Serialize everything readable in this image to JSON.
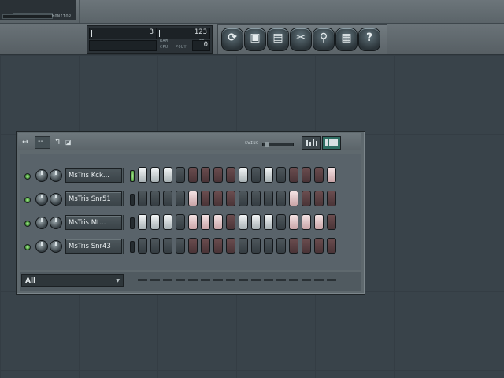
{
  "top_panel": {
    "monitor_label": "MONITOR",
    "pattern_number": "3",
    "tempo": "123",
    "ram_label": "RAM",
    "mb_label": "MB",
    "cpu_label": "CPU",
    "poly_label": "POLY",
    "poly_value": "0"
  },
  "toolbar": {
    "buttons": [
      {
        "name": "refresh-icon",
        "glyph": "⟳"
      },
      {
        "name": "save-as-icon",
        "glyph": "▣"
      },
      {
        "name": "save-icon",
        "glyph": "▤"
      },
      {
        "name": "tools-icon",
        "glyph": "✂"
      },
      {
        "name": "search-icon",
        "glyph": "⚲"
      },
      {
        "name": "document-icon",
        "glyph": "▦"
      },
      {
        "name": "help-icon",
        "glyph": "?"
      }
    ]
  },
  "channel_rack": {
    "title_icons": [
      "↔",
      "--",
      "↰",
      "◪"
    ],
    "swing_label": "SWING",
    "swing_level": 0.1,
    "channels": [
      {
        "name": "MsTris Kck...",
        "selected": true,
        "steps": [
          1,
          1,
          1,
          0,
          0,
          0,
          0,
          0,
          1,
          0,
          1,
          0,
          0,
          0,
          0,
          1
        ]
      },
      {
        "name": "MsTris Snr51",
        "selected": false,
        "steps": [
          0,
          0,
          0,
          0,
          1,
          0,
          0,
          0,
          0,
          0,
          0,
          0,
          1,
          0,
          0,
          0
        ]
      },
      {
        "name": "MsTris Mt...",
        "selected": false,
        "steps": [
          1,
          1,
          1,
          0,
          1,
          1,
          1,
          0,
          1,
          1,
          1,
          0,
          1,
          1,
          1,
          0
        ]
      },
      {
        "name": "MsTris Snr43",
        "selected": false,
        "steps": [
          0,
          0,
          0,
          0,
          0,
          0,
          0,
          0,
          0,
          0,
          0,
          0,
          0,
          0,
          0,
          0
        ]
      }
    ],
    "filter_value": "All"
  }
}
